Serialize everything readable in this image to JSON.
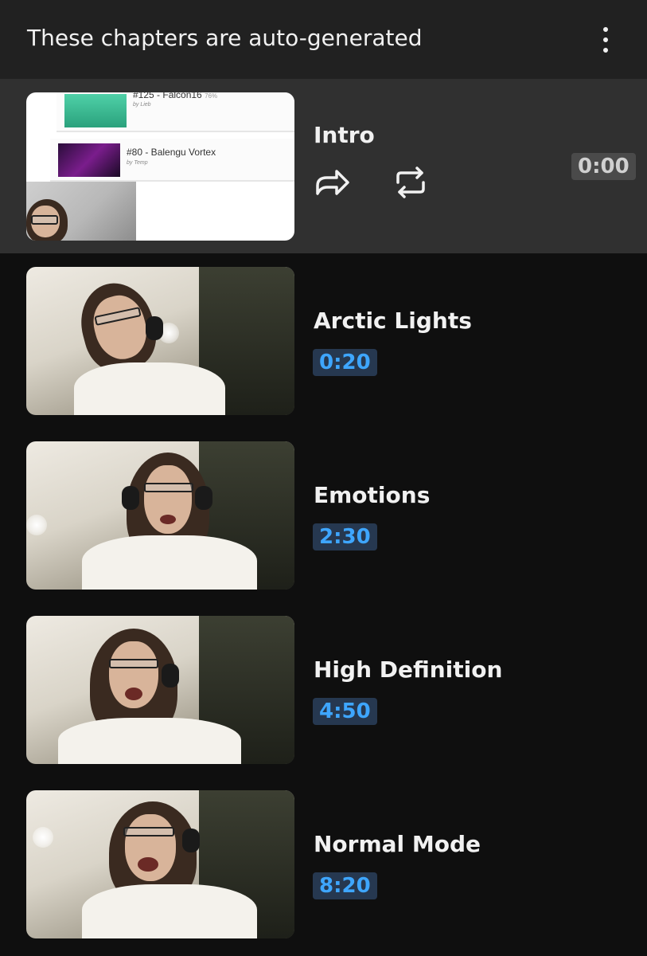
{
  "header": {
    "title": "These chapters are auto-generated",
    "menu_icon": "more-vertical-icon"
  },
  "colors": {
    "page_bg": "#0f0f0f",
    "header_bg": "#212121",
    "active_bg": "#303030",
    "timestamp_text": "#3ea6ff",
    "timestamp_bg": "#263850"
  },
  "intro_thumbnail": {
    "rows": [
      {
        "title": "#125 - Falcon16",
        "percent": "76%",
        "by": "by Lieb"
      },
      {
        "title": "#80 - Balengu Vortex",
        "by": "by Temp"
      }
    ]
  },
  "chapters": [
    {
      "title": "Intro",
      "timestamp": "0:00",
      "active": true,
      "actions": [
        "share-icon",
        "repeat-icon"
      ]
    },
    {
      "title": "Arctic Lights",
      "timestamp": "0:20"
    },
    {
      "title": "Emotions",
      "timestamp": "2:30"
    },
    {
      "title": "High Definition",
      "timestamp": "4:50"
    },
    {
      "title": "Normal Mode",
      "timestamp": "8:20"
    }
  ]
}
